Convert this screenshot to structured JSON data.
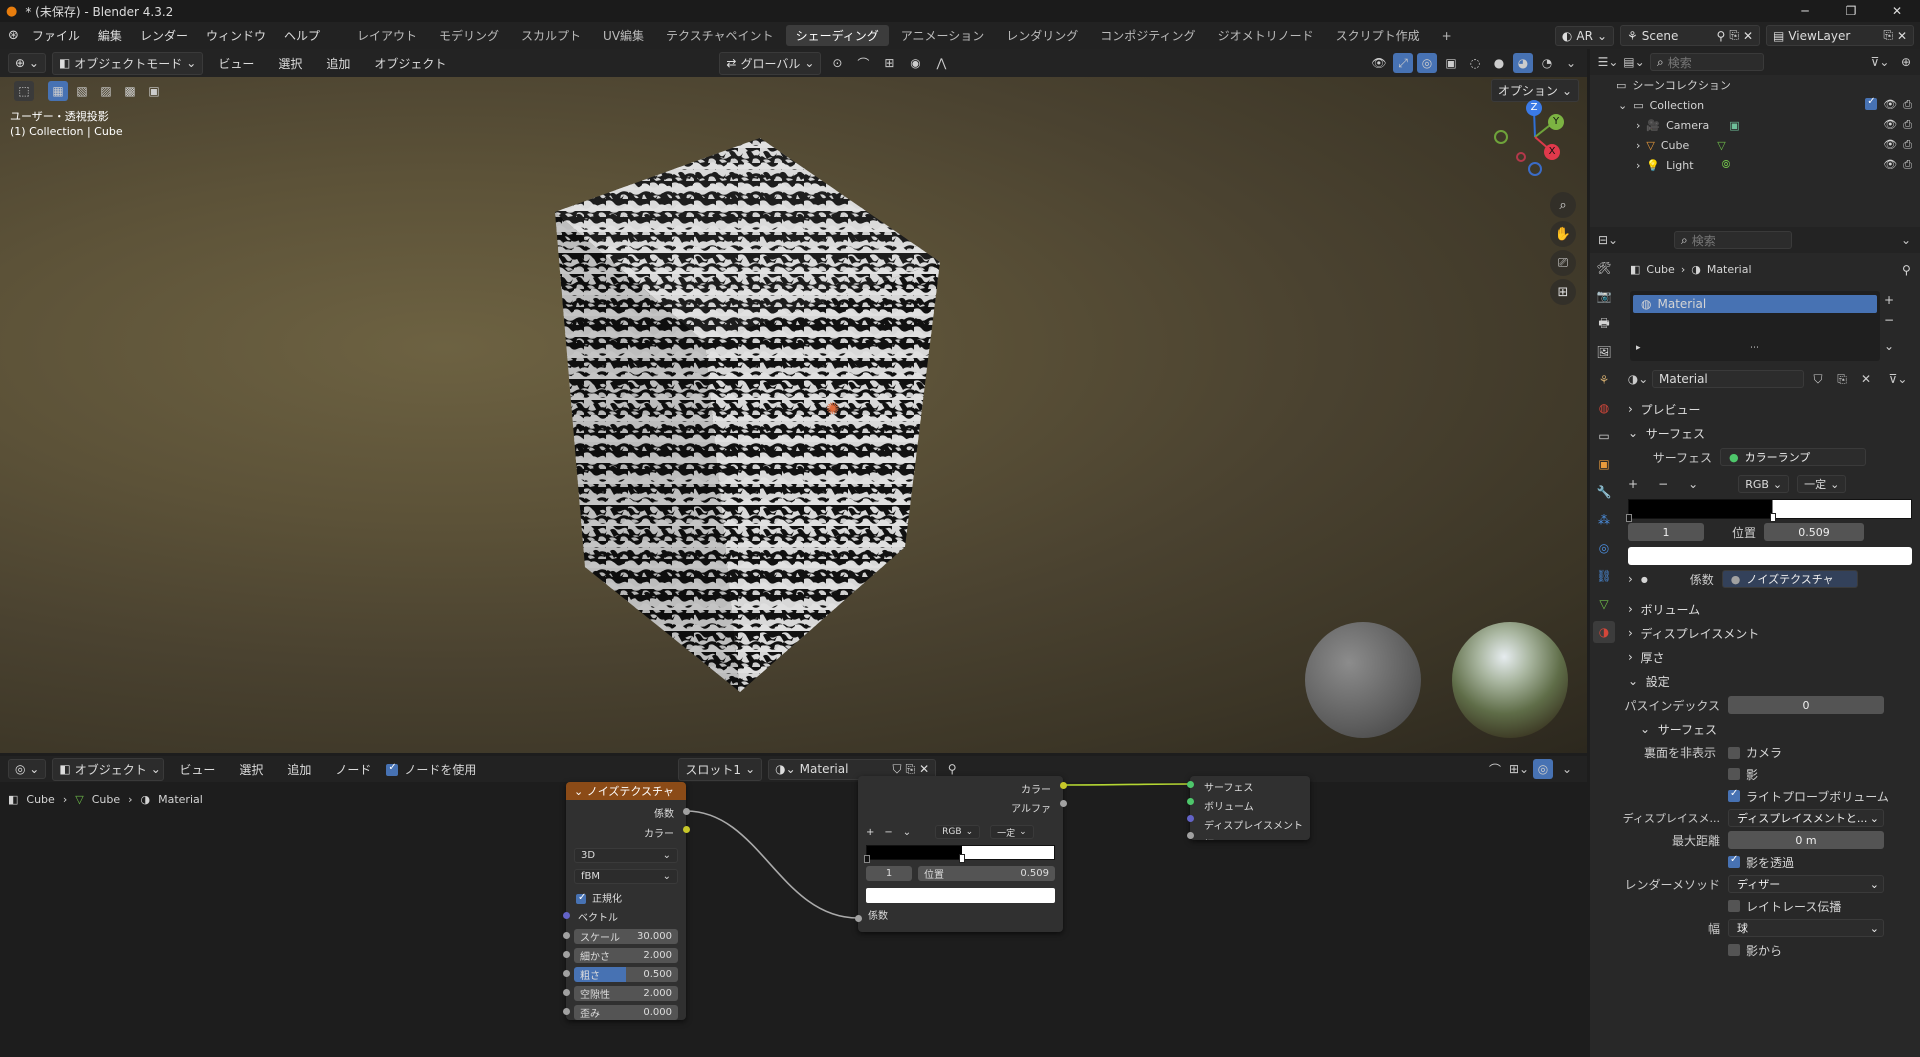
{
  "window": {
    "title": "* (未保存) - Blender 4.3.2",
    "min": "─",
    "max": "❐",
    "close": "✕"
  },
  "menu": {
    "items": [
      "ファイル",
      "編集",
      "レンダー",
      "ウィンドウ",
      "ヘルプ"
    ]
  },
  "workspaces": {
    "items": [
      "レイアウト",
      "モデリング",
      "スカルプト",
      "UV編集",
      "テクスチャペイント",
      "シェーディング",
      "アニメーション",
      "レンダリング",
      "コンポジティング",
      "ジオメトリノード",
      "スクリプト作成"
    ],
    "active_index": 5,
    "add": "+"
  },
  "top_right": {
    "engine": "AR",
    "scene": "Scene",
    "viewlayer": "ViewLayer"
  },
  "viewport_header": {
    "mode": "オブジェクトモード",
    "menus": [
      "ビュー",
      "選択",
      "追加",
      "オブジェクト"
    ],
    "orientation": "グローバル",
    "options": "オプション"
  },
  "viewport": {
    "view_name": "ユーザー・透視投影",
    "collection_line": "(1) Collection | Cube"
  },
  "gizmo": {
    "z": "Z",
    "y": "Y",
    "x": "X"
  },
  "node_header": {
    "editor": "オブジェクト",
    "menus": [
      "ビュー",
      "選択",
      "追加",
      "ノード"
    ],
    "use_nodes": "ノードを使用",
    "slot": "スロット1",
    "material": "Material"
  },
  "node_breadcrumb": {
    "object": "Cube",
    "mesh": "Cube",
    "material": "Material"
  },
  "noise_node": {
    "title": "ノイズテクスチャ",
    "out_fac": "係数",
    "out_color": "カラー",
    "dim": "3D",
    "type": "fBM",
    "normalize": "正規化",
    "vector": "ベクトル",
    "fields": [
      {
        "label": "スケール",
        "value": "30.000"
      },
      {
        "label": "細かさ",
        "value": "2.000"
      },
      {
        "label": "粗さ",
        "value": "0.500",
        "fill": 0.5
      },
      {
        "label": "空隙性",
        "value": "2.000"
      },
      {
        "label": "歪み",
        "value": "0.000"
      }
    ]
  },
  "ramp_node": {
    "out_color": "カラー",
    "out_alpha": "アルファ",
    "mode": "RGB",
    "interp": "一定",
    "index": "1",
    "pos_label": "位置",
    "pos_value": "0.509",
    "stop_position": 0.509,
    "in_fac": "係数",
    "plus": "+",
    "minus": "−",
    "chev": "⌄"
  },
  "output_node": {
    "surface": "サーフェス",
    "volume": "ボリューム",
    "displacement": "ディスプレイスメント",
    "thickness": "幅"
  },
  "outliner": {
    "search_placeholder": "検索",
    "scene_collection": "シーンコレクション",
    "collection": "Collection",
    "items": [
      "Camera",
      "Cube",
      "Light"
    ]
  },
  "properties": {
    "search_placeholder": "検索",
    "breadcrumb_obj": "Cube",
    "breadcrumb_mat": "Material",
    "slot_name": "Material",
    "material_name": "Material",
    "preview": "プレビュー",
    "surface": "サーフェス",
    "surface_label": "サーフェス",
    "surface_value": "カラーランプ",
    "ramp_mode": "RGB",
    "ramp_interp": "一定",
    "ramp_index": "1",
    "ramp_pos_label": "位置",
    "ramp_pos_value": "0.509",
    "ramp_stop_position": 0.509,
    "fac_label": "係数",
    "fac_value": "ノイズテクスチャ",
    "volume": "ボリューム",
    "displacement": "ディスプレイスメント",
    "thickness": "厚さ",
    "settings": "設定",
    "pass_index_label": "パスインデックス",
    "pass_index_value": "0",
    "sub_surface": "サーフェス",
    "backface_label": "裏面を非表示",
    "camera": "カメラ",
    "shadow": "影",
    "light_probe": "ライトプローブボリューム",
    "disp_label": "ディスプレイスメ...",
    "disp_value": "ディスプレイスメントと...",
    "max_dist_label": "最大距離",
    "max_dist_value": "0 m",
    "transparent_shadow": "影を透過",
    "render_method_label": "レンダーメソッド",
    "render_method_value": "ディザー",
    "raytrace": "レイトレース伝播",
    "thickness_label": "幅",
    "thickness_value": "球",
    "from_shadow": "影から"
  }
}
